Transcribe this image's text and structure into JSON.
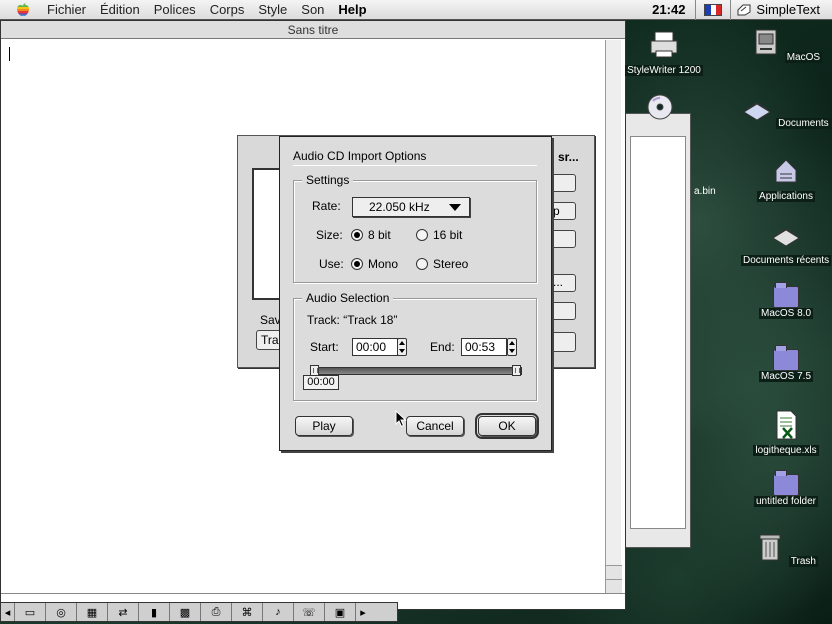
{
  "menubar": {
    "items": [
      "Fichier",
      "Édition",
      "Polices",
      "Corps",
      "Style",
      "Son",
      "Help"
    ],
    "clock": "21:42",
    "app_name": "SimpleText",
    "flag_colors": [
      "#1f3fb0",
      "#ffffff",
      "#d62828"
    ]
  },
  "document_window": {
    "title": "Sans titre"
  },
  "background_window": {
    "title_fragment": "sr...",
    "label_fragment": "Sav",
    "field_fragment": "Tra",
    "button_fragments": [
      "p",
      "...",
      ""
    ]
  },
  "side_window": {
    "file_fragment": "a.bin"
  },
  "dialog": {
    "title": "Audio CD Import Options",
    "settings": {
      "group_label": "Settings",
      "rate_label": "Rate:",
      "rate_value": "22.050 kHz",
      "size_label": "Size:",
      "size_options": [
        "8 bit",
        "16 bit"
      ],
      "size_selected": "8 bit",
      "use_label": "Use:",
      "use_options": [
        "Mono",
        "Stereo"
      ],
      "use_selected": "Mono"
    },
    "audio_selection": {
      "group_label": "Audio Selection",
      "track_text": "Track: “Track 18”",
      "start_label": "Start:",
      "start_value": "00:00",
      "end_label": "End:",
      "end_value": "00:53",
      "tooltip_value": "00:00"
    },
    "buttons": {
      "play": "Play",
      "cancel": "Cancel",
      "ok": "OK"
    }
  },
  "desktop_icons": [
    {
      "label": "StyleWriter 1200",
      "icon": "printer-icon"
    },
    {
      "label": "MacOS",
      "icon": "hard-disk-icon"
    },
    {
      "label": "Documents",
      "icon": "documents-icon"
    },
    {
      "label": "Applications",
      "icon": "applications-icon"
    },
    {
      "label": "Documents récents",
      "icon": "recent-documents-icon"
    },
    {
      "label": "MacOS 8.0",
      "icon": "system-folder-icon"
    },
    {
      "label": "MacOS 7.5",
      "icon": "system-folder-icon"
    },
    {
      "label": "logitheque.xls",
      "icon": "excel-file-icon"
    },
    {
      "label": "untitled folder",
      "icon": "folder-icon"
    },
    {
      "label": "Trash",
      "icon": "trash-icon"
    }
  ]
}
